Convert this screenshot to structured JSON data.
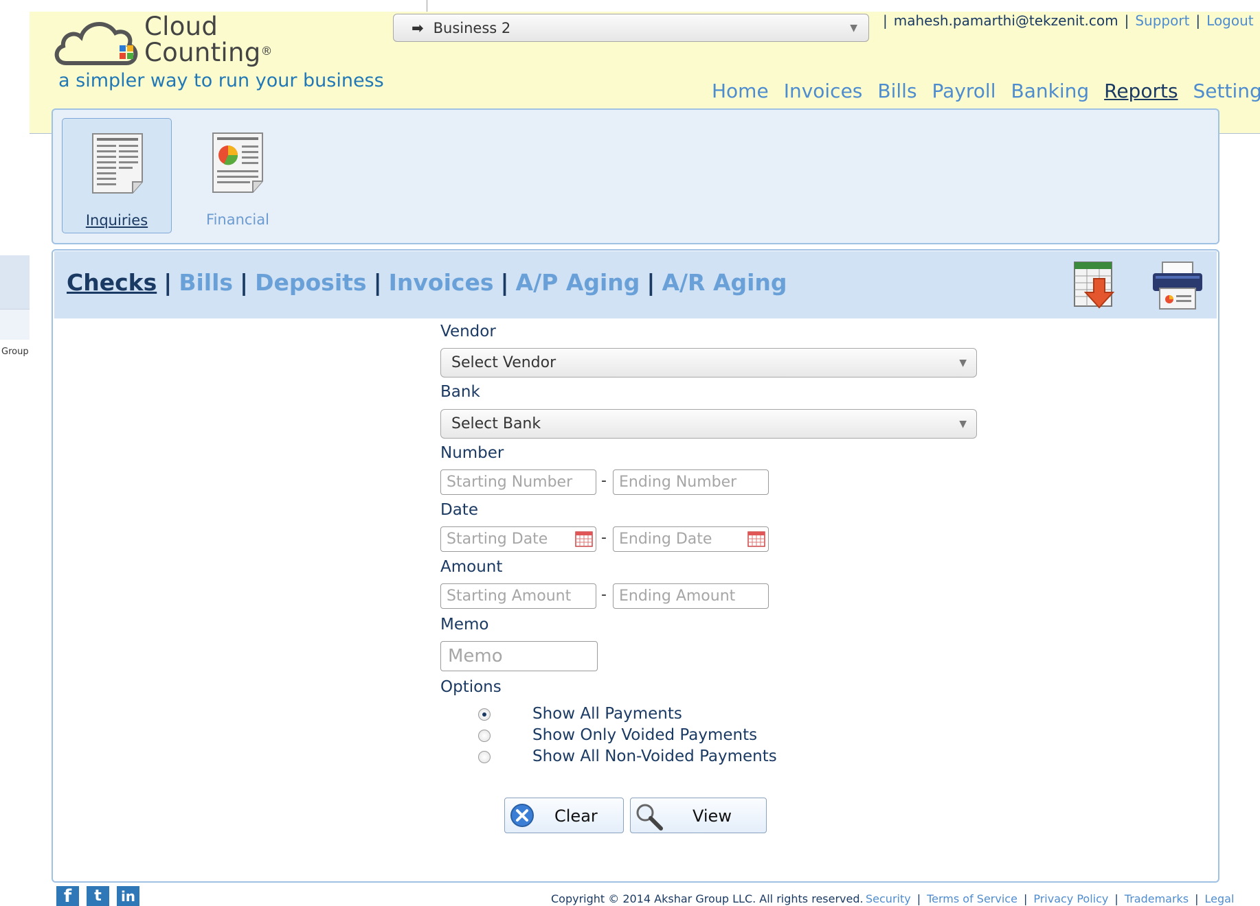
{
  "logo": {
    "line1": "Cloud",
    "line2": "Counting",
    "mark": "®",
    "tagline": "a simpler way to run your business"
  },
  "business_select": {
    "selected": "Business 2",
    "prefix": "➡",
    "caret": "▼"
  },
  "user_links": {
    "email": "mahesh.pamarthi@tekzenit.com",
    "support": "Support",
    "logout": "Logout",
    "sep": "|"
  },
  "main_nav": {
    "items": [
      "Home",
      "Invoices",
      "Bills",
      "Payroll",
      "Banking",
      "Reports",
      "Settings"
    ],
    "active": "Reports"
  },
  "report_categories": {
    "items": [
      {
        "label": "Inquiries",
        "icon": "document-icon",
        "active": true
      },
      {
        "label": "Financial",
        "icon": "pie-chart-document-icon",
        "active": false
      }
    ]
  },
  "left_stub": {
    "text": "Group"
  },
  "inquiry_tabs": {
    "items": [
      "Checks",
      "Bills",
      "Deposits",
      "Invoices",
      "A/P Aging",
      "A/R Aging"
    ],
    "active": "Checks",
    "sep": "|"
  },
  "toolbar_icons": {
    "export": "export-spreadsheet-icon",
    "print": "printer-icon"
  },
  "form": {
    "vendor": {
      "label": "Vendor",
      "value": "Select Vendor"
    },
    "bank": {
      "label": "Bank",
      "value": "Select Bank"
    },
    "number": {
      "label": "Number",
      "start_placeholder": "Starting Number",
      "end_placeholder": "Ending Number"
    },
    "date": {
      "label": "Date",
      "start_placeholder": "Starting Date",
      "end_placeholder": "Ending Date",
      "icon": "calendar-icon"
    },
    "amount": {
      "label": "Amount",
      "start_placeholder": "Starting Amount",
      "end_placeholder": "Ending Amount"
    },
    "memo": {
      "label": "Memo",
      "placeholder": "Memo"
    },
    "range_sep": "-",
    "options": {
      "label": "Options",
      "items": [
        {
          "label": "Show All Payments",
          "selected": true
        },
        {
          "label": "Show Only Voided Payments",
          "selected": false
        },
        {
          "label": "Show All Non-Voided Payments",
          "selected": false
        }
      ]
    },
    "buttons": {
      "clear": "Clear",
      "view": "View"
    }
  },
  "footer": {
    "social": [
      "f",
      "t",
      "in"
    ],
    "copyright": "Copyright © 2014 Akshar Group LLC. All rights reserved.",
    "links": [
      "Security",
      "Terms of Service",
      "Privacy Policy",
      "Trademarks",
      "Legal"
    ],
    "sep": "|"
  },
  "colors": {
    "header_bg": "#fbfbcd",
    "panel_bg": "#e7f0f9",
    "tabbar_bg": "#d0e2f4",
    "link": "#4e8cd0",
    "dark_text": "#1b3a63"
  }
}
